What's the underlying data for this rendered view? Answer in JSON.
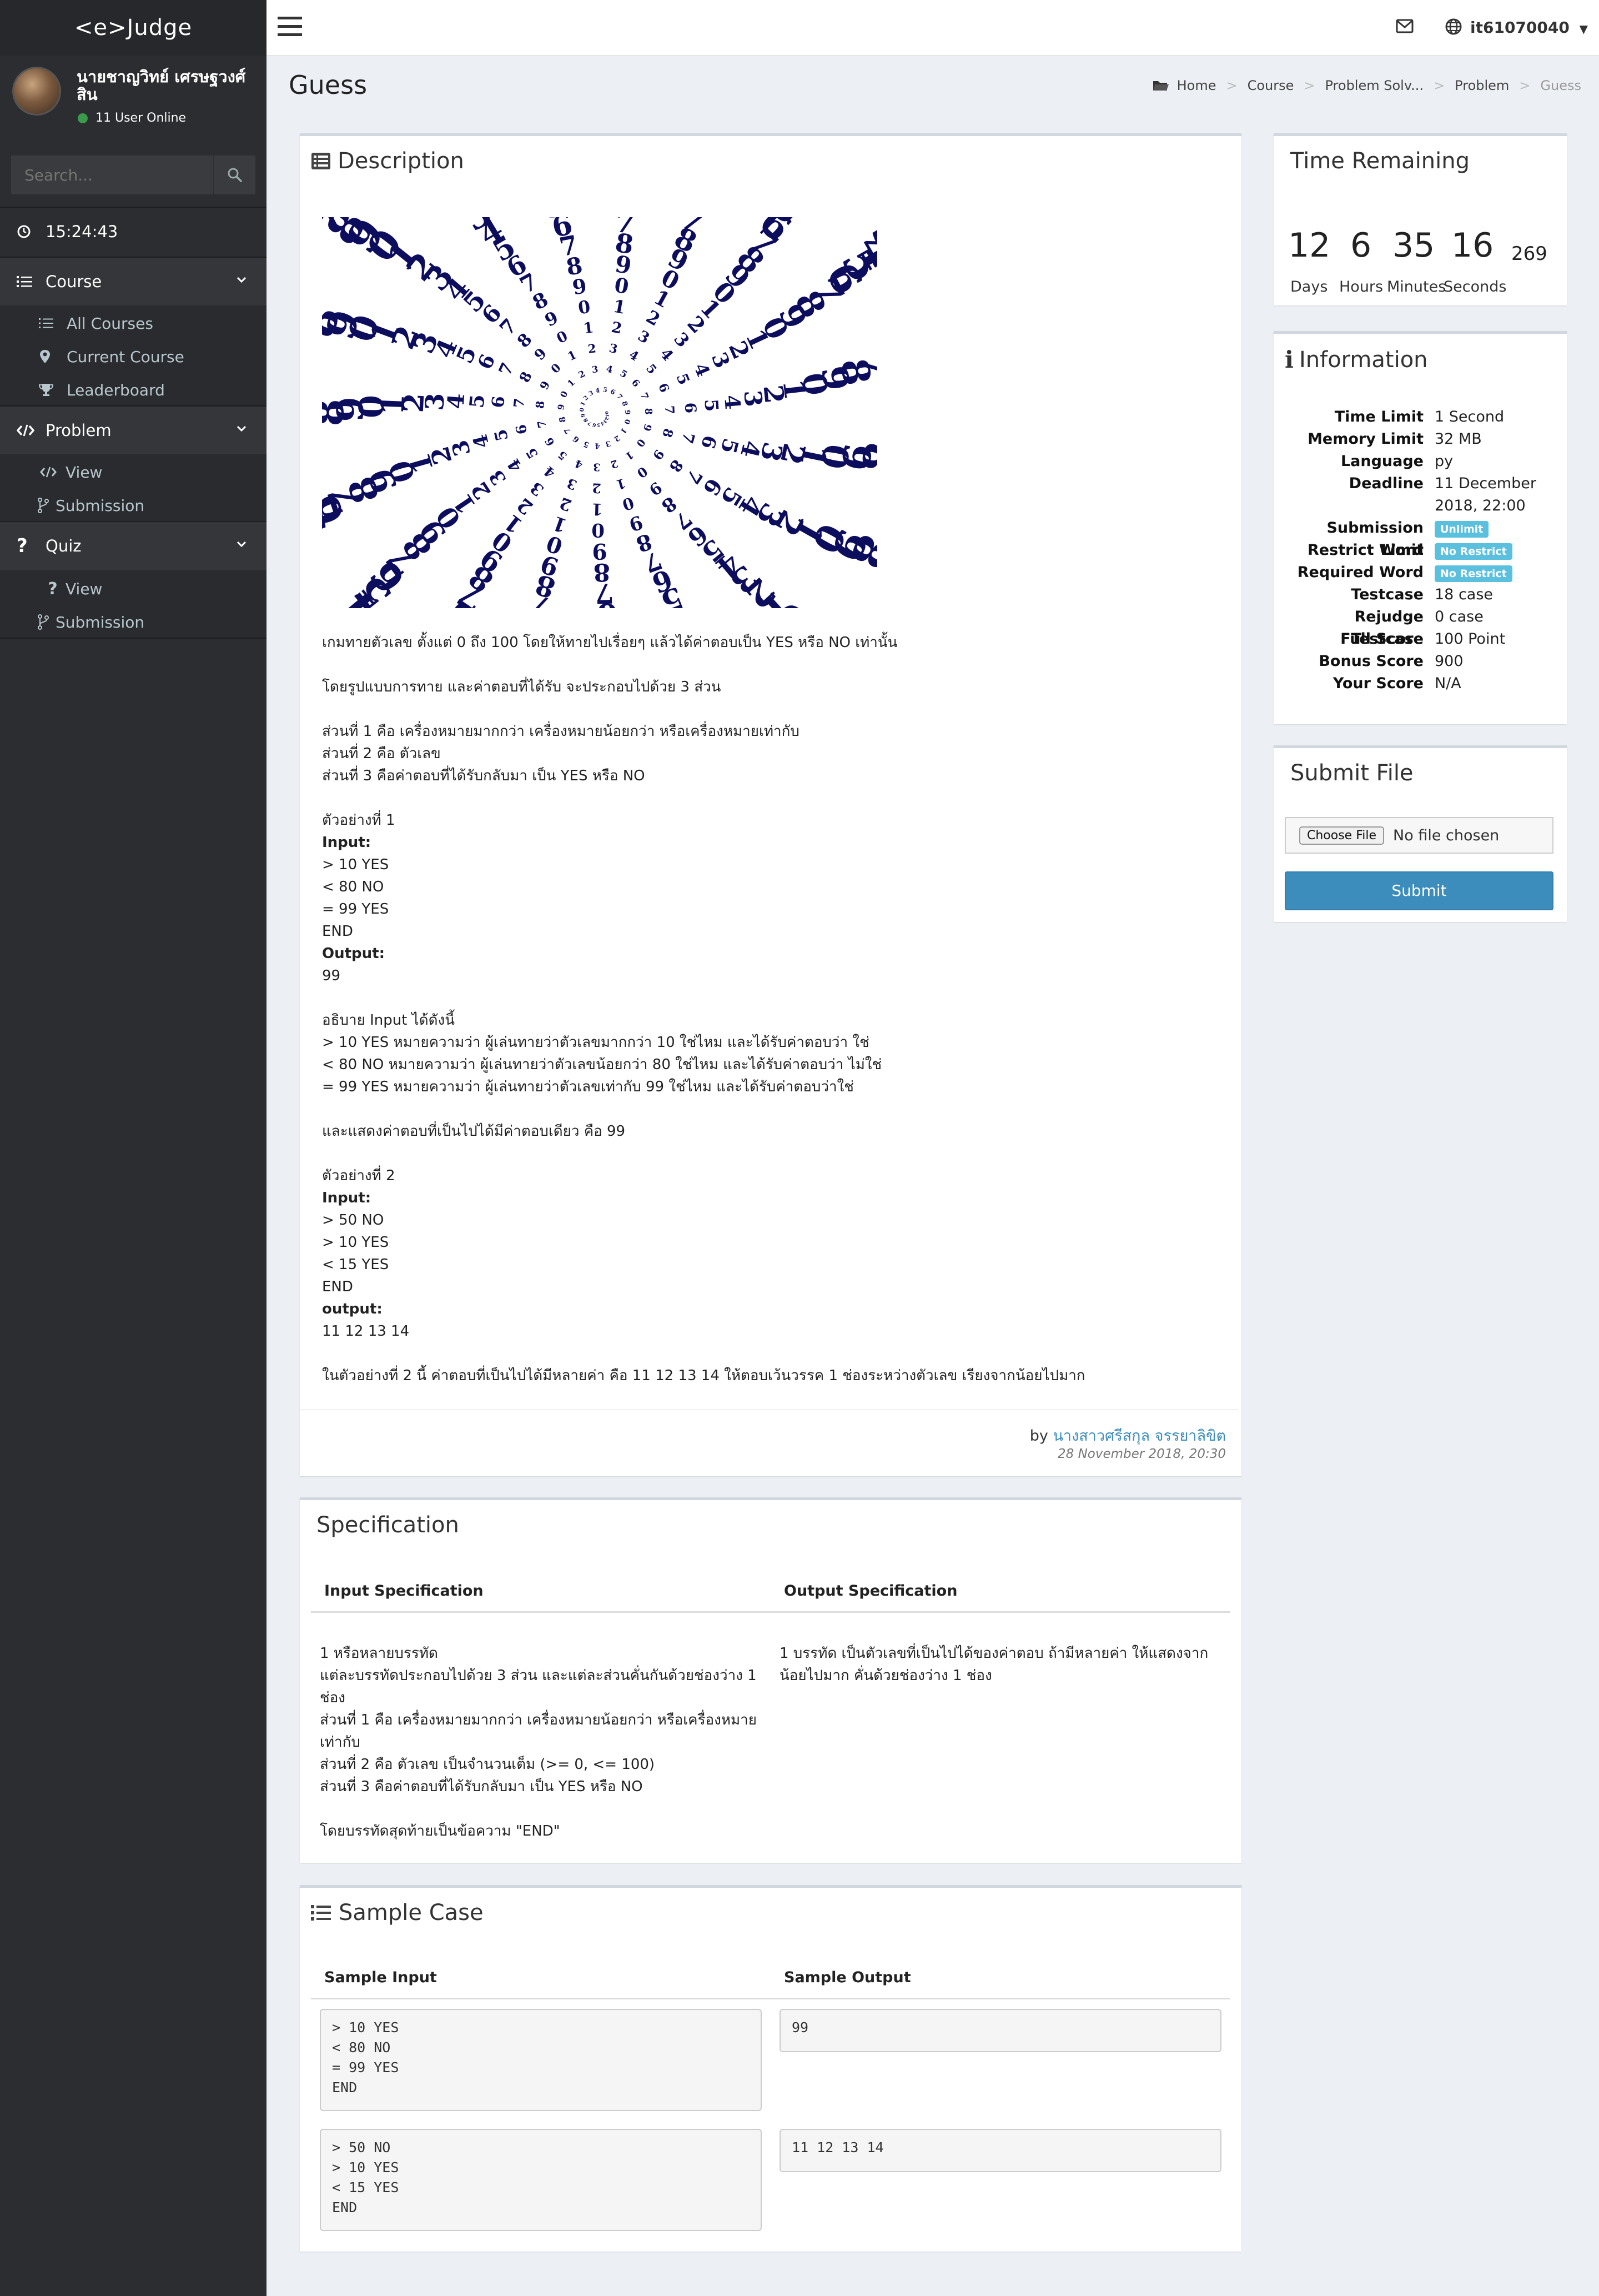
{
  "app": {
    "logo": "<e>Judge"
  },
  "user": {
    "name": "นายชาญวิทย์ เศรษฐวงศ์สิน",
    "online": "11 User Online",
    "account": "it61070040"
  },
  "search": {
    "placeholder": "Search..."
  },
  "clock": {
    "time": "15:24:43"
  },
  "sidebar": {
    "course": {
      "label": "Course",
      "items": [
        "All Courses",
        "Current Course",
        "Leaderboard"
      ]
    },
    "problem": {
      "label": "Problem",
      "items": [
        "View",
        "Submission"
      ]
    },
    "quiz": {
      "label": "Quiz",
      "items": [
        "View",
        "Submission"
      ]
    }
  },
  "page": {
    "title": "Guess"
  },
  "breadcrumb": [
    "Home",
    "Course",
    "Problem Solv...",
    "Problem",
    "Guess"
  ],
  "description": {
    "title": "Description",
    "lines": [
      "เกมทายตัวเลข ตั้งแต่ 0 ถึง 100 โดยให้ทายไปเรื่อยๆ แล้วได้ค่าตอบเป็น YES หรือ NO เท่านั้น",
      "",
      "โดยรูปแบบการทาย และค่าตอบที่ได้รับ จะประกอบไปด้วย 3 ส่วน",
      "",
      "ส่วนที่ 1 คือ เครื่องหมายมากกว่า เครื่องหมายน้อยกว่า หรือเครื่องหมายเท่ากับ",
      "ส่วนที่ 2 คือ ตัวเลข",
      "ส่วนที่ 3 คือค่าตอบที่ได้รับกลับมา เป็น YES หรือ NO",
      "",
      "ตัวอย่างที่ 1",
      "Input:",
      "> 10 YES",
      "< 80 NO",
      "= 99 YES",
      "END",
      "Output:",
      "99",
      "",
      "อธิบาย Input ได้ดังนี้",
      "> 10 YES หมายความว่า ผู้เล่นทายว่าตัวเลขมากกว่า 10 ใช่ไหม และได้รับค่าตอบว่า ใช่",
      "< 80 NO หมายความว่า ผู้เล่นทายว่าตัวเลขน้อยกว่า 80 ใช่ไหม และได้รับค่าตอบว่า ไม่ใช่",
      "= 99 YES หมายความว่า ผู้เล่นทายว่าตัวเลขเท่ากับ 99 ใช่ไหม และได้รับค่าตอบว่าใช่",
      "",
      "และแสดงค่าตอบที่เป็นไปได้มีค่าตอบเดียว คือ 99",
      "",
      "ตัวอย่างที่ 2",
      "Input:",
      "> 50 NO",
      "> 10 YES",
      "< 15 YES",
      "END",
      "output:",
      "11 12 13 14",
      "",
      "ในตัวอย่างที่ 2 นี้ ค่าตอบที่เป็นไปได้มีหลายค่า คือ 11 12 13 14 ให้ตอบเว้นวรรค 1 ช่องระหว่างตัวเลข เรียงจากน้อยไปมาก"
    ],
    "bold_lines": [
      9,
      14,
      25,
      30
    ],
    "author_prefix": "by",
    "author": "นางสาวศรีสกุล จรรยาลิขิต",
    "date": "28 November 2018, 20:30"
  },
  "specification": {
    "title": "Specification",
    "input_header": "Input Specification",
    "output_header": "Output Specification",
    "input_lines": [
      "1 หรือหลายบรรทัด",
      "แต่ละบรรทัดประกอบไปด้วย 3 ส่วน และแต่ละส่วนคั่นกันด้วยช่องว่าง 1",
      "ช่อง",
      "ส่วนที่ 1 คือ เครื่องหมายมากกว่า เครื่องหมายน้อยกว่า หรือเครื่องหมาย",
      "เท่ากับ",
      "ส่วนที่ 2 คือ ตัวเลข เป็นจำนวนเต็ม (>= 0, <= 100)",
      "ส่วนที่ 3 คือค่าตอบที่ได้รับกลับมา เป็น YES หรือ NO",
      "",
      "โดยบรรทัดสุดท้ายเป็นข้อความ \"END\""
    ],
    "output_lines": [
      "1 บรรทัด เป็นตัวเลขที่เป็นไปได้ของค่าตอบ ถ้ามีหลายค่า ให้แสดงจาก",
      "น้อยไปมาก คั่นด้วยช่องว่าง 1 ช่อง"
    ]
  },
  "sample": {
    "title": "Sample Case",
    "input_header": "Sample Input",
    "output_header": "Sample Output",
    "cases": [
      {
        "input": "> 10 YES\n< 80 NO\n= 99 YES\nEND",
        "output": "99"
      },
      {
        "input": "> 50 NO\n> 10 YES\n< 15 YES\nEND",
        "output": "11 12 13 14"
      }
    ]
  },
  "timer": {
    "title": "Time Remaining",
    "days": "12",
    "hours": "6",
    "minutes": "35",
    "seconds": "16",
    "ms": "269",
    "days_label": "Days",
    "hours_label": "Hours",
    "minutes_label": "Minutes",
    "seconds_label": "Seconds"
  },
  "info": {
    "title": "Information",
    "rows": [
      {
        "key": "Time Limit",
        "value": "1 Second"
      },
      {
        "key": "Memory Limit",
        "value": "32 MB"
      },
      {
        "key": "Language",
        "value": "py"
      },
      {
        "key": "Deadline",
        "value": "11 December 2018, 22:00"
      },
      {
        "key": "Submission Limit",
        "value": "Unlimit",
        "badge": true
      },
      {
        "key": "Restrict Word",
        "value": "No Restrict",
        "badge": true
      },
      {
        "key": "Required Word",
        "value": "No Restrict",
        "badge": true
      },
      {
        "key": "Testcase",
        "value": "18 case"
      },
      {
        "key": "Rejudge Testcase",
        "value": "0 case"
      },
      {
        "key": "Full Score",
        "value": "100 Point"
      },
      {
        "key": "Bonus Score",
        "value": "900"
      },
      {
        "key": "Your Score",
        "value": "N/A"
      }
    ]
  },
  "submit": {
    "title": "Submit File",
    "choose_label": "Choose File",
    "file_status": "No file chosen",
    "button": "Submit"
  },
  "colors": {
    "sidebar": "#2c2d30",
    "accent": "#3c8dbc",
    "badge": "#5bc0de",
    "spiral_digits": "#0d0d5e"
  },
  "icons": [
    "hamburger-icon",
    "envelope-icon",
    "globe-icon",
    "search-icon",
    "clock-icon",
    "list-icon",
    "map-marker-icon",
    "trophy-icon",
    "code-icon",
    "code-fork-icon",
    "question-icon",
    "folder-icon",
    "info-icon"
  ]
}
